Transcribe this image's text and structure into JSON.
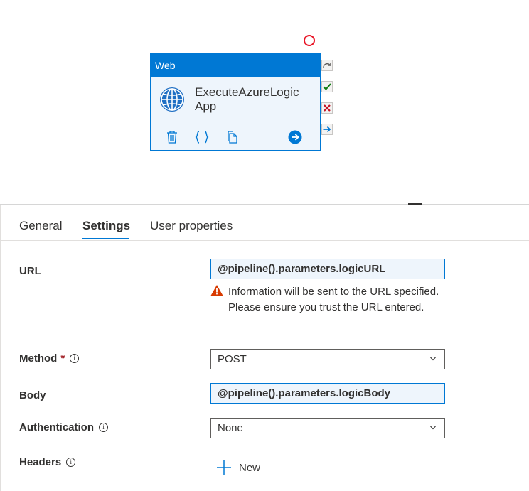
{
  "activity": {
    "type_label": "Web",
    "name": "ExecuteAzureLogic App",
    "icons": [
      "web-globe-icon",
      "delete-icon",
      "code-icon",
      "copy-icon",
      "go-icon"
    ],
    "ports": [
      "skip-port",
      "success-port",
      "failure-port",
      "completion-port"
    ]
  },
  "tabs": [
    {
      "label": "General"
    },
    {
      "label": "Settings",
      "selected": true
    },
    {
      "label": "User properties"
    }
  ],
  "settings": {
    "url": {
      "label": "URL",
      "value": "@pipeline().parameters.logicURL",
      "warning": "Information will be sent to the URL specified. Please ensure you trust the URL entered."
    },
    "method": {
      "label": "Method",
      "required_marker": "*",
      "value": "POST"
    },
    "body": {
      "label": "Body",
      "value": "@pipeline().parameters.logicBody"
    },
    "authentication": {
      "label": "Authentication",
      "value": "None"
    },
    "headers": {
      "label": "Headers",
      "new_label": "New"
    }
  },
  "colors": {
    "accent": "#0078d4",
    "expression_bg": "#eef5fc",
    "error": "#e81123",
    "success": "#107c10",
    "warning": "#d83b01"
  }
}
